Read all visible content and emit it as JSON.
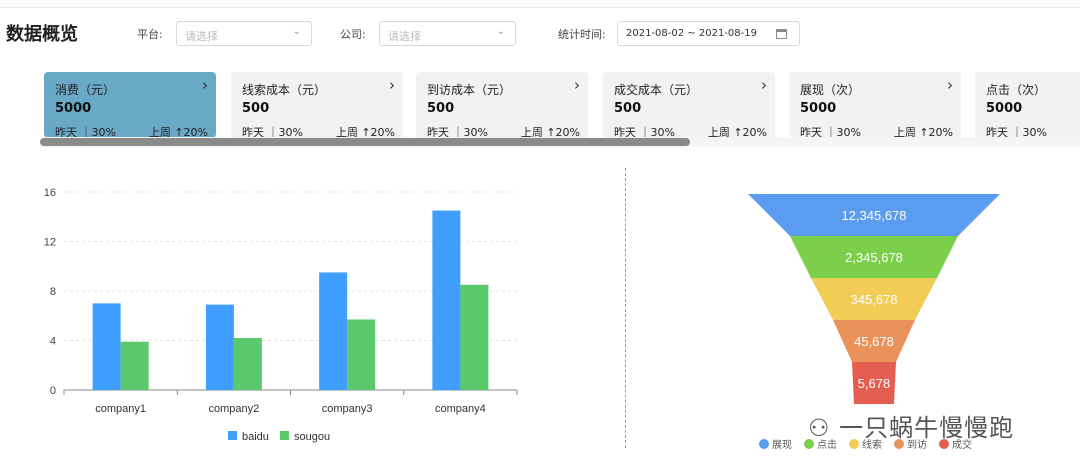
{
  "page": {
    "title": "数据概览"
  },
  "filters": {
    "platform_label": "平台:",
    "platform_placeholder": "请选择",
    "company_label": "公司:",
    "company_placeholder": "请选择",
    "time_label": "统计时间:",
    "date_range": "2021-08-02 ~ 2021-08-19"
  },
  "cards": [
    {
      "title": "消费（元）",
      "value": "5000",
      "yesterday": "昨天 ｜30%",
      "week": "上周 ↑20%",
      "active": true
    },
    {
      "title": "线索成本（元）",
      "value": "500",
      "yesterday": "昨天 ｜30%",
      "week": "上周 ↑20%"
    },
    {
      "title": "到访成本（元）",
      "value": "500",
      "yesterday": "昨天 ｜30%",
      "week": "上周 ↑20%"
    },
    {
      "title": "成交成本（元）",
      "value": "500",
      "yesterday": "昨天 ｜30%",
      "week": "上周 ↑20%"
    },
    {
      "title": "展现（次）",
      "value": "5000",
      "yesterday": "昨天 ｜30%",
      "week": "上周 ↑20%"
    },
    {
      "title": "点击（次）",
      "value": "5000",
      "yesterday": "昨天 ｜30%",
      "week": ""
    }
  ],
  "chart_data": [
    {
      "type": "bar",
      "categories": [
        "company1",
        "company2",
        "company3",
        "company4"
      ],
      "series": [
        {
          "name": "baidu",
          "values": [
            7,
            6.9,
            9.5,
            14.5
          ],
          "color": "#409eff"
        },
        {
          "name": "sougou",
          "values": [
            3.9,
            4.2,
            5.7,
            8.5
          ],
          "color": "#59c96b"
        }
      ],
      "yticks": [
        0,
        4,
        8,
        12,
        16
      ],
      "ylim": [
        0,
        16
      ],
      "grid": true,
      "legend": "bottom"
    },
    {
      "type": "funnel",
      "stages": [
        {
          "name": "展现",
          "value": 12345678,
          "label": "12,345,678",
          "color": "#5b9cf0"
        },
        {
          "name": "点击",
          "value": 2345678,
          "label": "2,345,678",
          "color": "#7ccf4b"
        },
        {
          "name": "线索",
          "value": 345678,
          "label": "345,678",
          "color": "#f2cd56"
        },
        {
          "name": "到访",
          "value": 45678,
          "label": "45,678",
          "color": "#e9935a"
        },
        {
          "name": "成交",
          "value": 5678,
          "label": "5,678",
          "color": "#e35e51"
        }
      ],
      "legend": "bottom"
    }
  ],
  "watermark": {
    "text": "一只蜗牛慢慢跑",
    "icon": "wechat-icon"
  }
}
